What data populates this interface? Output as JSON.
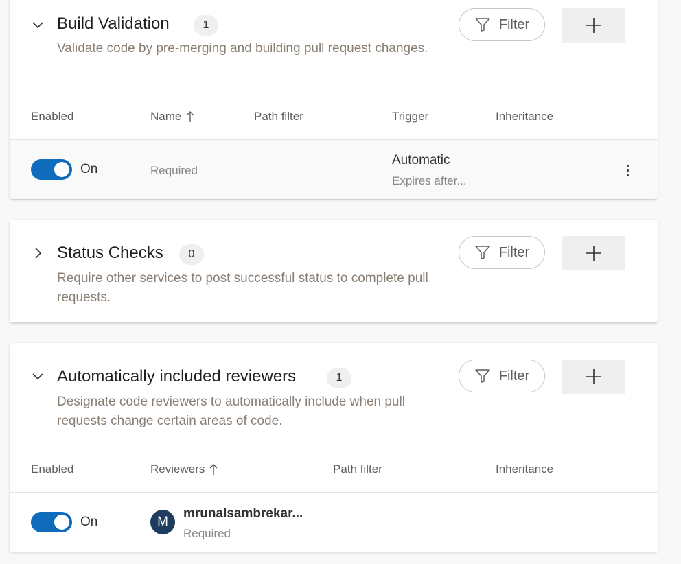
{
  "colors": {
    "accent": "#0f6cbd",
    "description": "#8a7f74",
    "avatar": "#1e3c5e"
  },
  "build_validation": {
    "title": "Build Validation",
    "count": "1",
    "description": "Validate code by pre-merging and building pull request changes.",
    "filter_label": "Filter",
    "columns": {
      "enabled": "Enabled",
      "name": "Name",
      "path_filter": "Path filter",
      "trigger": "Trigger",
      "inheritance": "Inheritance"
    },
    "row": {
      "toggle_label": "On",
      "name_status": "Required",
      "trigger": "Automatic",
      "trigger_detail": "Expires after..."
    }
  },
  "status_checks": {
    "title": "Status Checks",
    "count": "0",
    "description": "Require other services to post successful status to complete pull requests.",
    "filter_label": "Filter"
  },
  "reviewers": {
    "title": "Automatically included reviewers",
    "count": "1",
    "description": "Designate code reviewers to automatically include when pull requests change certain areas of code.",
    "filter_label": "Filter",
    "columns": {
      "enabled": "Enabled",
      "reviewers": "Reviewers",
      "path_filter": "Path filter",
      "inheritance": "Inheritance"
    },
    "row": {
      "toggle_label": "On",
      "avatar_initial": "M",
      "reviewer_name": "mrunalsambrekar...",
      "reviewer_status": "Required"
    }
  }
}
